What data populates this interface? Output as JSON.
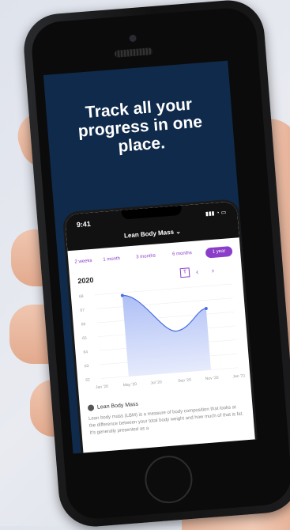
{
  "headline_lines": [
    "Track all your",
    "progress in one",
    "place."
  ],
  "app": {
    "time": "9:41",
    "title": "Lean Body Mass ⌄",
    "tabs": [
      "2 weeks",
      "1 month",
      "3 months",
      "6 months",
      "1 year"
    ],
    "active_tab": "1 year",
    "year": "2020",
    "ctrl_t": "T",
    "ctrl_prev": "‹",
    "ctrl_next": "›",
    "legend": "Lean Body Mass",
    "description": "Lean body mass (LBM) is a measure of body composition that looks at the difference between your total body weight and how much of that is fat. It's generally presented as a"
  },
  "chart_data": {
    "type": "area",
    "y_ticks": [
      "68",
      "67",
      "66",
      "65",
      "64",
      "63",
      "62"
    ],
    "x_ticks": [
      "Jan '20",
      "May '20",
      "Jul '20",
      "Sep '20",
      "Nov '20",
      "Jan '21"
    ],
    "points": [
      {
        "x": "May '20",
        "y": 67.8
      },
      {
        "x": "Nov '20",
        "y": 66.4
      }
    ],
    "ylim": [
      62,
      68
    ],
    "fill_color": "#aebff5",
    "line_color": "#4a6fe0"
  }
}
